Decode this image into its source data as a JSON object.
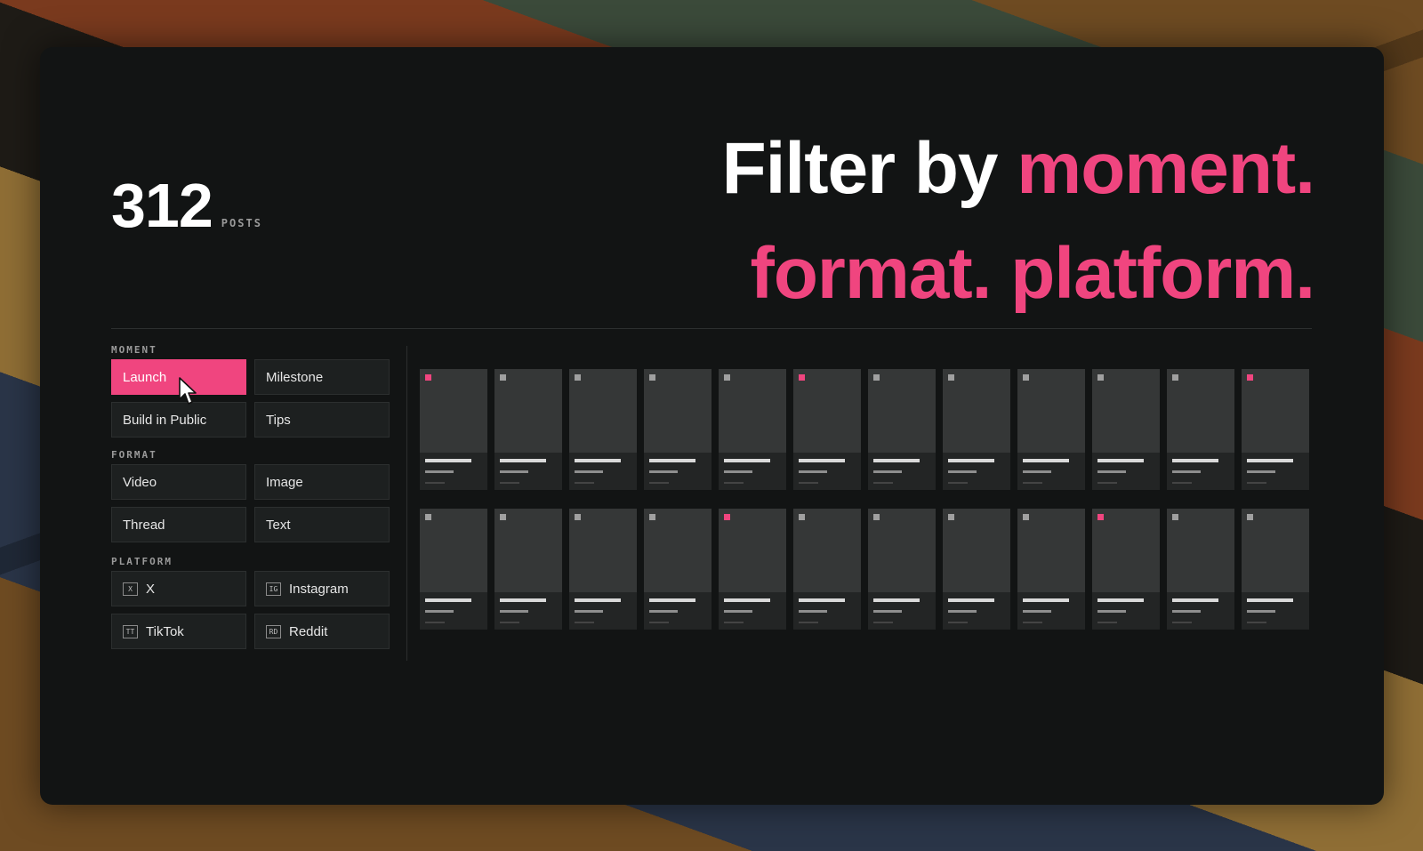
{
  "stats": {
    "count": "312",
    "label": "POSTS"
  },
  "headline": {
    "line1_white": "Filter by ",
    "line1_pink": "moment.",
    "line2_pink": "format. platform."
  },
  "filters": {
    "moment": {
      "label": "MOMENT",
      "options": [
        "Launch",
        "Milestone",
        "Build in Public",
        "Tips"
      ],
      "selected": "Launch"
    },
    "format": {
      "label": "FORMAT",
      "options": [
        "Video",
        "Image",
        "Thread",
        "Text"
      ]
    },
    "platform": {
      "label": "PLATFORM",
      "options": [
        {
          "badge": "X",
          "name": "X"
        },
        {
          "badge": "IG",
          "name": "Instagram"
        },
        {
          "badge": "TT",
          "name": "TikTok"
        },
        {
          "badge": "RD",
          "name": "Reddit"
        }
      ]
    }
  },
  "colors": {
    "accent": "#f0457f",
    "panel": "#121414",
    "chip": "#1d2020"
  },
  "posts": [
    {
      "highlighted": true
    },
    {
      "highlighted": false
    },
    {
      "highlighted": false
    },
    {
      "highlighted": false
    },
    {
      "highlighted": false
    },
    {
      "highlighted": true
    },
    {
      "highlighted": false
    },
    {
      "highlighted": false
    },
    {
      "highlighted": false
    },
    {
      "highlighted": false
    },
    {
      "highlighted": false
    },
    {
      "highlighted": true
    },
    {
      "highlighted": false
    },
    {
      "highlighted": false
    },
    {
      "highlighted": false
    },
    {
      "highlighted": false
    },
    {
      "highlighted": true
    },
    {
      "highlighted": false
    },
    {
      "highlighted": false
    },
    {
      "highlighted": false
    },
    {
      "highlighted": false
    },
    {
      "highlighted": true
    },
    {
      "highlighted": false
    },
    {
      "highlighted": false
    }
  ]
}
